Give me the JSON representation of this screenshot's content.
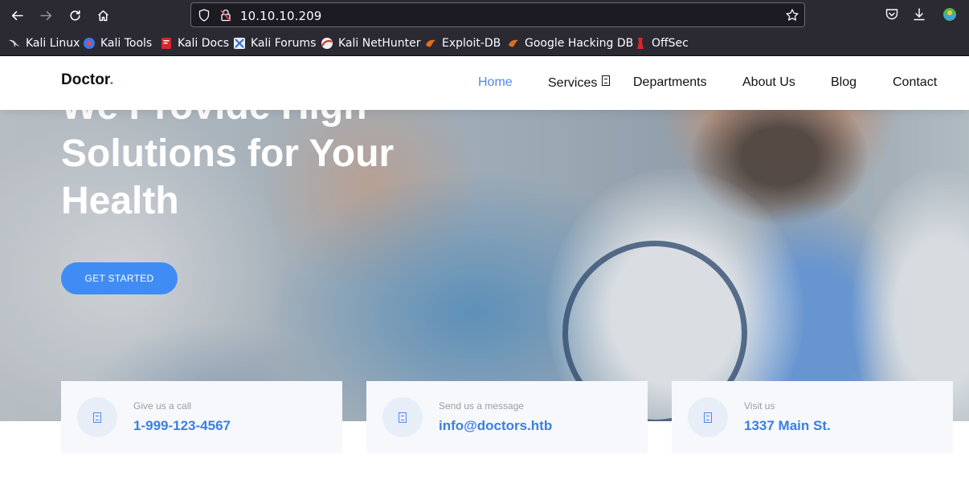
{
  "browser": {
    "url": "10.10.10.209",
    "back_icon": "back-arrow-icon",
    "forward_icon": "forward-arrow-icon",
    "reload_icon": "reload-icon",
    "home_icon": "home-icon",
    "bookmarks": [
      {
        "label": "Kali Linux",
        "icon": "kali-dragon-icon"
      },
      {
        "label": "Kali Tools",
        "icon": "kali-tools-icon"
      },
      {
        "label": "Kali Docs",
        "icon": "kali-docs-icon"
      },
      {
        "label": "Kali Forums",
        "icon": "kali-forums-icon"
      },
      {
        "label": "Kali NetHunter",
        "icon": "kali-nethunter-icon"
      },
      {
        "label": "Exploit-DB",
        "icon": "exploit-db-icon"
      },
      {
        "label": "Google Hacking DB",
        "icon": "ghdb-icon"
      },
      {
        "label": "OffSec",
        "icon": "offsec-icon"
      }
    ]
  },
  "site": {
    "logo": "Doctor",
    "logo_dot": ".",
    "nav": {
      "home": "Home",
      "services": "Services",
      "departments": "Departments",
      "about": "About Us",
      "blog": "Blog",
      "contact": "Contact"
    },
    "hero": {
      "line1": "We Provide High",
      "line2": "Solutions for Your",
      "line3": "Health",
      "cta": "GET STARTED"
    },
    "cards": [
      {
        "label": "Give us a call",
        "value": "1-999-123-4567"
      },
      {
        "label": "Send us a message",
        "value": "info@doctors.htb"
      },
      {
        "label": "Visit us",
        "value": "1337 Main St."
      }
    ]
  },
  "colors": {
    "accent": "#4f87f0",
    "cta": "#3f8cf5",
    "chrome": "#2b2a33",
    "urlbar": "#1c1b22"
  }
}
